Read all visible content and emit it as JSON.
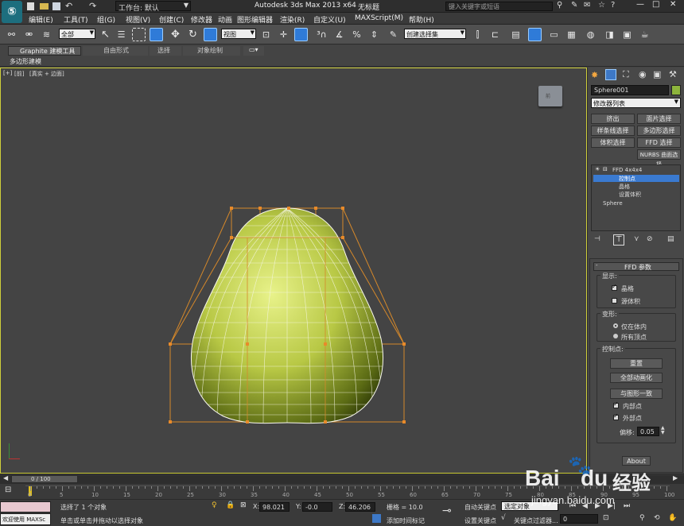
{
  "titlebar": {
    "workspace_label": "工作台: 默认",
    "title": "Autodesk 3ds Max  2013 x64",
    "doc": "无标题",
    "search_placeholder": "键入关键字或短语"
  },
  "menus": [
    "编辑(E)",
    "工具(T)",
    "组(G)",
    "视图(V)",
    "创建(C)",
    "修改器",
    "动画",
    "图形编辑器",
    "渲染(R)",
    "自定义(U)",
    "MAXScript(M)",
    "帮助(H)"
  ],
  "toolbar": {
    "selection_filter": "全部",
    "ref_coord": "视图",
    "named_selection": "创建选择集"
  },
  "ribbon": {
    "tabs": [
      "Graphite 建模工具",
      "自由形式",
      "选择",
      "对象绘制"
    ],
    "panel_label": "多边形建模"
  },
  "viewport": {
    "label_plus": "[+]",
    "label_view": "[前]",
    "label_shading": "[真实 + 边面]"
  },
  "command_panel": {
    "object_name": "Sphere001",
    "object_color": "#8db43c",
    "modifier_list": "修改器列表",
    "mod_buttons": [
      "挤出",
      "面片选择",
      "样条线选择",
      "多边形选择",
      "体积选择",
      "FFD 选择",
      "NURBS 曲面选择"
    ],
    "stack": {
      "ffd": "FFD 4x4x4",
      "sub_items": [
        "控制点",
        "晶格",
        "设置体积"
      ],
      "base": "Sphere"
    },
    "rollout_title": "FFD 参数",
    "display_group": "显示:",
    "lattice": "晶格",
    "source_volume": "源体积",
    "deform_group": "变形:",
    "only_in_volume": "仅在体内",
    "all_vertices": "所有顶点",
    "control_points_group": "控制点:",
    "reset": "重置",
    "animate_all": "全部动画化",
    "conform": "与图形一致",
    "inside_points": "内部点",
    "outside_points": "外部点",
    "offset_label": "偏移:",
    "offset_value": "0.05",
    "about": "About"
  },
  "timeline": {
    "frame_display": "0 / 100",
    "ticks": [
      "0",
      "5",
      "10",
      "15",
      "20",
      "25",
      "30",
      "35",
      "40",
      "45",
      "50",
      "55",
      "60",
      "65",
      "70",
      "75",
      "80",
      "85",
      "90",
      "95",
      "100"
    ]
  },
  "status": {
    "welcome": "欢迎使用 MAXSc",
    "selected": "选择了 1 个对象",
    "prompt": "单击或单击并拖动以选择对象",
    "x_label": "X:",
    "x_value": "98.021",
    "y_label": "Y:",
    "y_value": "-0.0",
    "z_label": "Z:",
    "z_value": "46.206",
    "grid": "栅格 = 10.0",
    "add_time_tag": "添加时间标记",
    "auto_key": "自动关键点",
    "set_key": "设置关键点",
    "selected_obj": "选定对象",
    "key_filter": "关键点过滤器...",
    "frame_field": "0"
  },
  "watermark": {
    "brand": "Bai",
    "brand2": "du",
    "jingyan": "经验",
    "url": "jingyan.baidu.com"
  }
}
